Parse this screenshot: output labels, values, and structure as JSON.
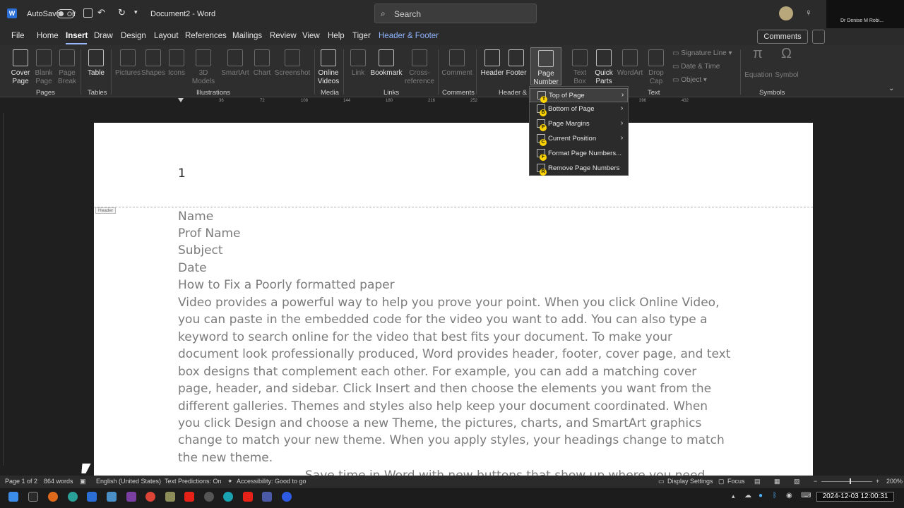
{
  "titlebar": {
    "autosave_label": "AutoSave",
    "autosave_state": "Off",
    "doc_title": "Document2 - Word",
    "search_placeholder": "Search",
    "account_name": "Dr Denise M Robi..."
  },
  "menu": {
    "items": [
      "File",
      "Home",
      "Insert",
      "Draw",
      "Design",
      "Layout",
      "References",
      "Mailings",
      "Review",
      "View",
      "Help",
      "Tiger",
      "Header & Footer"
    ],
    "active": "Insert",
    "comments_label": "Comments"
  },
  "ribbon": {
    "pages": {
      "cover": "Cover\nPage",
      "blank": "Blank\nPage",
      "break": "Page\nBreak",
      "group": "Pages"
    },
    "tables": {
      "table": "Table",
      "group": "Tables"
    },
    "illustrations": {
      "pictures": "Pictures",
      "shapes": "Shapes",
      "icons": "Icons",
      "models": "3D\nModels",
      "smartart": "SmartArt",
      "chart": "Chart",
      "screenshot": "Screenshot",
      "group": "Illustrations"
    },
    "media": {
      "videos": "Online\nVideos",
      "group": "Media"
    },
    "links": {
      "link": "Link",
      "bookmark": "Bookmark",
      "crossref": "Cross-\nreference",
      "group": "Links"
    },
    "comments": {
      "comment": "Comment",
      "group": "Comments"
    },
    "hf": {
      "header": "Header",
      "footer": "Footer",
      "pagenum": "Page\nNumber",
      "group": "Header & F"
    },
    "text": {
      "textbox": "Text\nBox",
      "quickparts": "Quick\nParts",
      "wordart": "WordArt",
      "dropcap": "Drop\nCap",
      "sigline": "Signature Line",
      "datetime": "Date & Time",
      "object": "Object",
      "group": "Text"
    },
    "symbols": {
      "equation": "Equation",
      "symbol": "Symbol",
      "group": "Symbols"
    }
  },
  "page_number_menu": [
    {
      "label": "Top of Page",
      "key": "T",
      "submenu": true
    },
    {
      "label": "Bottom of Page",
      "key": "B",
      "submenu": true
    },
    {
      "label": "Page Margins",
      "key": "P",
      "submenu": true
    },
    {
      "label": "Current Position",
      "key": "C",
      "submenu": true
    },
    {
      "label": "Format Page Numbers...",
      "key": "F",
      "submenu": false
    },
    {
      "label": "Remove Page Numbers",
      "key": "R",
      "submenu": false
    }
  ],
  "ruler": [
    "36",
    "72",
    "108",
    "144",
    "180",
    "216",
    "252",
    "396",
    "432"
  ],
  "document": {
    "page_number": "1",
    "header_tag": "Header",
    "lines": [
      "Name",
      "Prof Name",
      "Subject",
      "Date",
      "How to Fix a Poorly formatted paper"
    ],
    "paragraph": [
      "Video provides a powerful way to help you prove your point. When you click Online Video,",
      "you can paste in the embedded code for the video you want to add. You can also type a",
      "keyword to search online for the video that best fits your document. To make your",
      "document look professionally produced, Word provides header, footer, cover page, and text",
      "box designs that complement each other. For example, you can add a matching cover",
      "page, header, and sidebar. Click Insert and then choose the elements you want from the",
      "different galleries. Themes and styles also help keep your document coordinated. When",
      "you click Design and choose a new Theme, the pictures, charts, and SmartArt graphics",
      "change to match your new theme. When you apply styles, your headings change to match",
      "the new theme."
    ],
    "next_line": "Save time in Word with new buttons that show up where you need"
  },
  "status": {
    "page": "Page 1 of 2",
    "words": "864 words",
    "language": "English (United States)",
    "predictions": "Text Predictions: On",
    "accessibility": "Accessibility: Good to go",
    "display": "Display Settings",
    "focus": "Focus",
    "zoom": "200%"
  },
  "taskbar": {
    "clock": "2024-12-03 12:00:31"
  }
}
